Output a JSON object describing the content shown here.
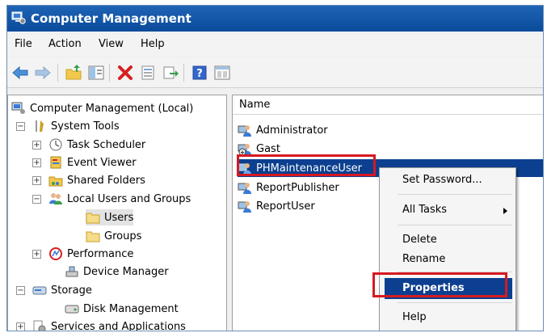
{
  "window": {
    "title": "Computer Management"
  },
  "menubar": {
    "items": [
      "File",
      "Action",
      "View",
      "Help"
    ]
  },
  "toolbar": {
    "buttons": [
      "back-icon",
      "forward-icon",
      "up-folder-icon",
      "show-hide-tree-icon",
      "delete-icon",
      "properties-icon",
      "export-icon",
      "help-icon",
      "console-icon"
    ]
  },
  "tree": {
    "root": "Computer Management (Local)",
    "system_tools": "System Tools",
    "task_scheduler": "Task Scheduler",
    "event_viewer": "Event Viewer",
    "shared_folders": "Shared Folders",
    "local_users_groups": "Local Users and Groups",
    "users": "Users",
    "groups": "Groups",
    "performance": "Performance",
    "device_manager": "Device Manager",
    "storage": "Storage",
    "disk_management": "Disk Management",
    "services_apps": "Services and Applications"
  },
  "list": {
    "column_name": "Name",
    "rows": [
      "Administrator",
      "Gast",
      "PHMaintenanceUser",
      "ReportPublisher",
      "ReportUser"
    ],
    "selected": "PHMaintenanceUser"
  },
  "context_menu": {
    "set_password": "Set Password...",
    "all_tasks": "All Tasks",
    "delete": "Delete",
    "rename": "Rename",
    "properties": "Properties",
    "help": "Help"
  },
  "colors": {
    "selection": "#0c3f8f",
    "highlight_box": "#d71920",
    "titlebar": "#1f63b5"
  }
}
